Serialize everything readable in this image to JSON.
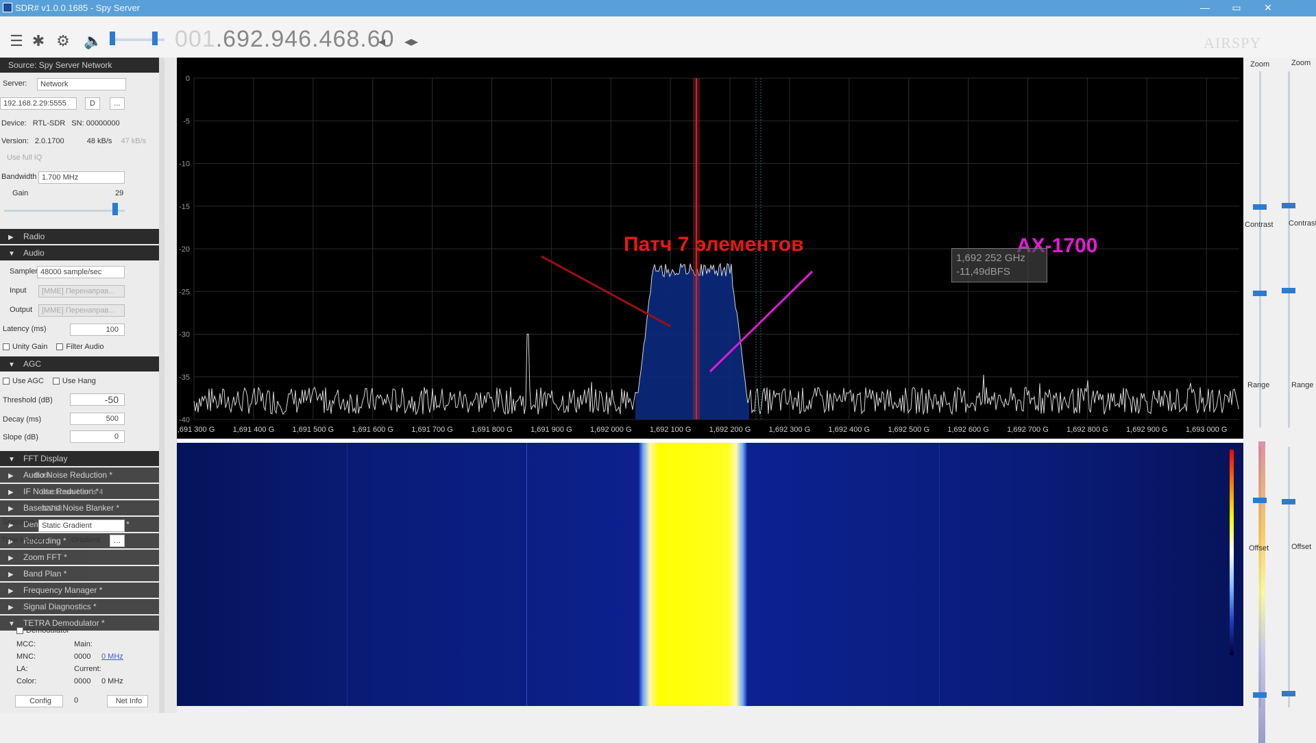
{
  "window": {
    "title": "SDR# v1.0.0.1685 - Spy Server",
    "minimize": "—",
    "maximize": "▭",
    "close": "✕"
  },
  "toolbar": {
    "menu_icon": "menu-icon",
    "settings_icon": "gear-icon",
    "play_icon": "gear-icon",
    "volume_icon": "speaker-icon",
    "frequency_faint": "001",
    "frequency": ".692.946.468.60",
    "tune_left": "◂",
    "tune_right": "◂▸",
    "brand": "AIRSPY"
  },
  "left_panel": {
    "source_header": "Source: Spy Server Network",
    "server_label": "Server:",
    "server_value": "Network",
    "address_value": "192.168.2.29:5555",
    "connect_button": "D",
    "dots_button": "...",
    "device_label": "Device:",
    "device_value": "RTL-SDR",
    "serial_label": "SN:",
    "serial_value": "00000000",
    "version_label": "Version:",
    "version_value": "2.0.1700",
    "rate_value": "48 kB/s",
    "rate_value2": "47 kB/s",
    "full_iq": "Use full IQ",
    "bandwidth_label": "Bandwidth",
    "bandwidth_value": "1.700 MHz",
    "gain_label": "Gain",
    "gain_value": "29",
    "radio_header": "Radio",
    "audio_header": "Audio",
    "samplerate_label": "Samplerate",
    "samplerate_value": "48000 sample/sec",
    "input_label": "Input",
    "input_value": "[MME] Перенаправ...",
    "output_label": "Output",
    "output_value": "[MME] Перенаправ...",
    "latency_label": "Latency (ms)",
    "latency_value": "100",
    "unity_gain": "Unity Gain",
    "filter_audio": "Filter Audio",
    "agc_header": "AGC",
    "use_agc": "Use AGC",
    "use_hang": "Use Hang",
    "threshold_label": "Threshold (dB)",
    "threshold_value": "-50",
    "decay_label": "Decay (ms)",
    "decay_value": "500",
    "slope_label": "Slope (dB)",
    "slope_value": "0",
    "fft_header": "FFT Display",
    "view_value": "Both",
    "window_value": "Blackman-Harris 4",
    "resolution_value": "32768",
    "spectrum_style_label": "Spectrum Style",
    "spectrum_style_value": "Static Gradient",
    "time_markers_label": "Time Markers",
    "gradient_label": "Gradient",
    "plugins": [
      "Audio Noise Reduction *",
      "IF Noise Reduction *",
      "Baseband Noise Blanker *",
      "Demodulator Noise Blanker *",
      "Recording *",
      "Zoom FFT *",
      "Band Plan *",
      "Frequency Manager *",
      "Signal Diagnostics *",
      "TETRA Demodulator *"
    ],
    "tetra_demodulator_label": "Demodulator",
    "mcc_label": "MCC:",
    "main_label": "Main:",
    "mnc_label": "MNC:",
    "mnc_value": "0000",
    "mnc_link": "0 MHz",
    "la_label": "LA:",
    "current_label": "Current:",
    "color_label": "Color:",
    "color_value": "0000",
    "color_freq": "0 MHz",
    "config_button": "Config",
    "config_value": "0",
    "net_info_button": "Net Info"
  },
  "spectrum": {
    "db_ticks": [
      "0",
      "-5",
      "-10",
      "-15",
      "-20",
      "-25",
      "-30",
      "-35",
      "-40"
    ],
    "freq_ticks": [
      "1,691 300 G",
      "1,691 400 G",
      "1,691 500 G",
      "1,691 600 G",
      "1,691 700 G",
      "1,691 800 G",
      "1,691 900 G",
      "1,692 000 G",
      "1,692 100 G",
      "1,692 200 G",
      "1,692 300 G",
      "1,692 400 G",
      "1,692 500 G",
      "1,692 600 G",
      "1,692 700 G",
      "1,692 800 G",
      "1,692 900 G",
      "1,693 000 G"
    ],
    "annotation_left": "Патч 7 элементов",
    "annotation_right": "AX-1700",
    "tooltip_freq": "1,692 252 GHz",
    "tooltip_level": "-11,49dBFS",
    "colors": {
      "signal_fill": "#0b2a80",
      "trace": "#d8d8d8",
      "center_marker": "#c62828",
      "grid": "#2a2a2a"
    }
  },
  "right_panel": {
    "zoom_label": "Zoom",
    "contrast_label": "Contrast",
    "range_label": "Range",
    "offset_label": "Offset"
  }
}
